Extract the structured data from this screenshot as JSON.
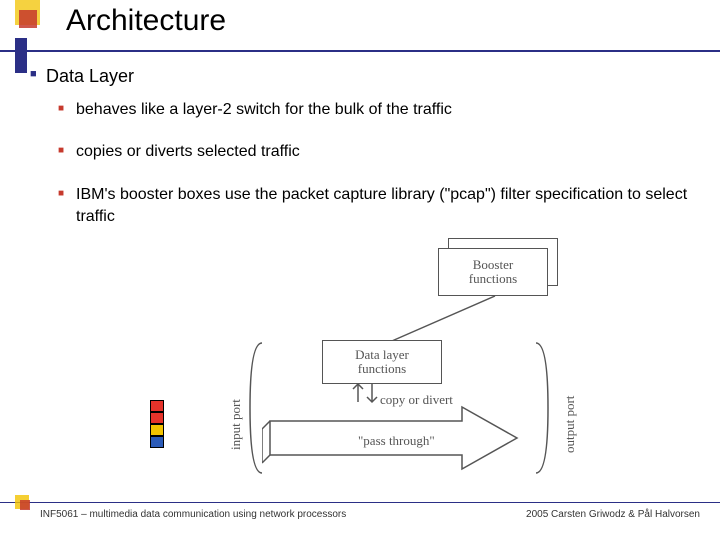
{
  "header": {
    "title": "Architecture"
  },
  "bullets": {
    "level1": "Data Layer",
    "sub1": "behaves like a layer-2 switch for the bulk of the traffic",
    "sub2": "copies or diverts selected traffic",
    "sub3": "IBM's booster boxes use the packet capture library (\"pcap\") filter specification to select traffic"
  },
  "diagram": {
    "booster_box": "Booster\nfunctions",
    "data_layer_box": "Data layer\nfunctions",
    "copy_divert": "copy or divert",
    "pass_through": "\"pass through\"",
    "input_port": "input port",
    "output_port": "output port"
  },
  "footer": {
    "left": "INF5061 – multimedia data communication using network processors",
    "right": "2005 Carsten Griwodz & Pål Halvorsen"
  },
  "colors": {
    "title_rule": "#2b2f86",
    "bullet1": "#2b2f86",
    "bullet2": "#c63a2d",
    "accent_yellow": "#f2c300"
  }
}
